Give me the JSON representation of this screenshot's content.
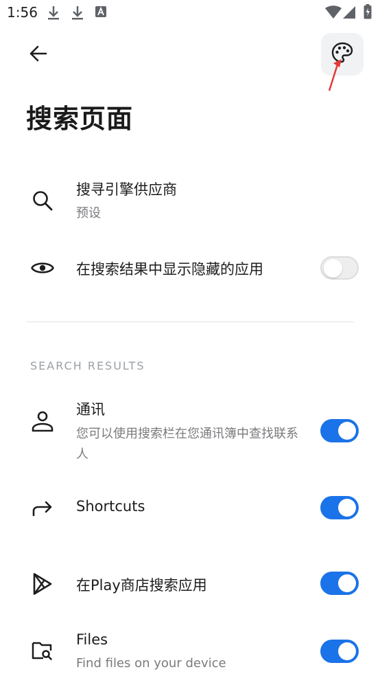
{
  "status_bar": {
    "time": "1:56",
    "icons": [
      "download-icon",
      "download-icon",
      "font-a-icon",
      "wifi-icon",
      "signal-icon",
      "battery-icon"
    ]
  },
  "header": {
    "back_icon": "arrow-left-icon",
    "palette_icon": "palette-icon",
    "title": "搜索页面"
  },
  "settings": {
    "search_engine": {
      "title": "搜寻引擎供应商",
      "value": "预设",
      "icon": "search-icon"
    },
    "show_hidden": {
      "title": "在搜索结果中显示隐藏的应用",
      "icon": "eye-icon",
      "enabled": false
    }
  },
  "section_header": "SEARCH RESULTS",
  "results": [
    {
      "icon": "person-icon",
      "title": "通讯",
      "subtitle": "您可以使用搜索栏在您通讯簿中查找联系人",
      "enabled": true
    },
    {
      "icon": "share-arrow-icon",
      "title": "Shortcuts",
      "subtitle": "",
      "enabled": true
    },
    {
      "icon": "play-store-icon",
      "title": "在Play商店搜索应用",
      "subtitle": "",
      "enabled": true
    },
    {
      "icon": "folder-search-icon",
      "title": "Files",
      "subtitle": "Find files on your device",
      "enabled": true
    }
  ],
  "colors": {
    "accent": "#1a73e8",
    "annotation_arrow": "#e53935"
  }
}
